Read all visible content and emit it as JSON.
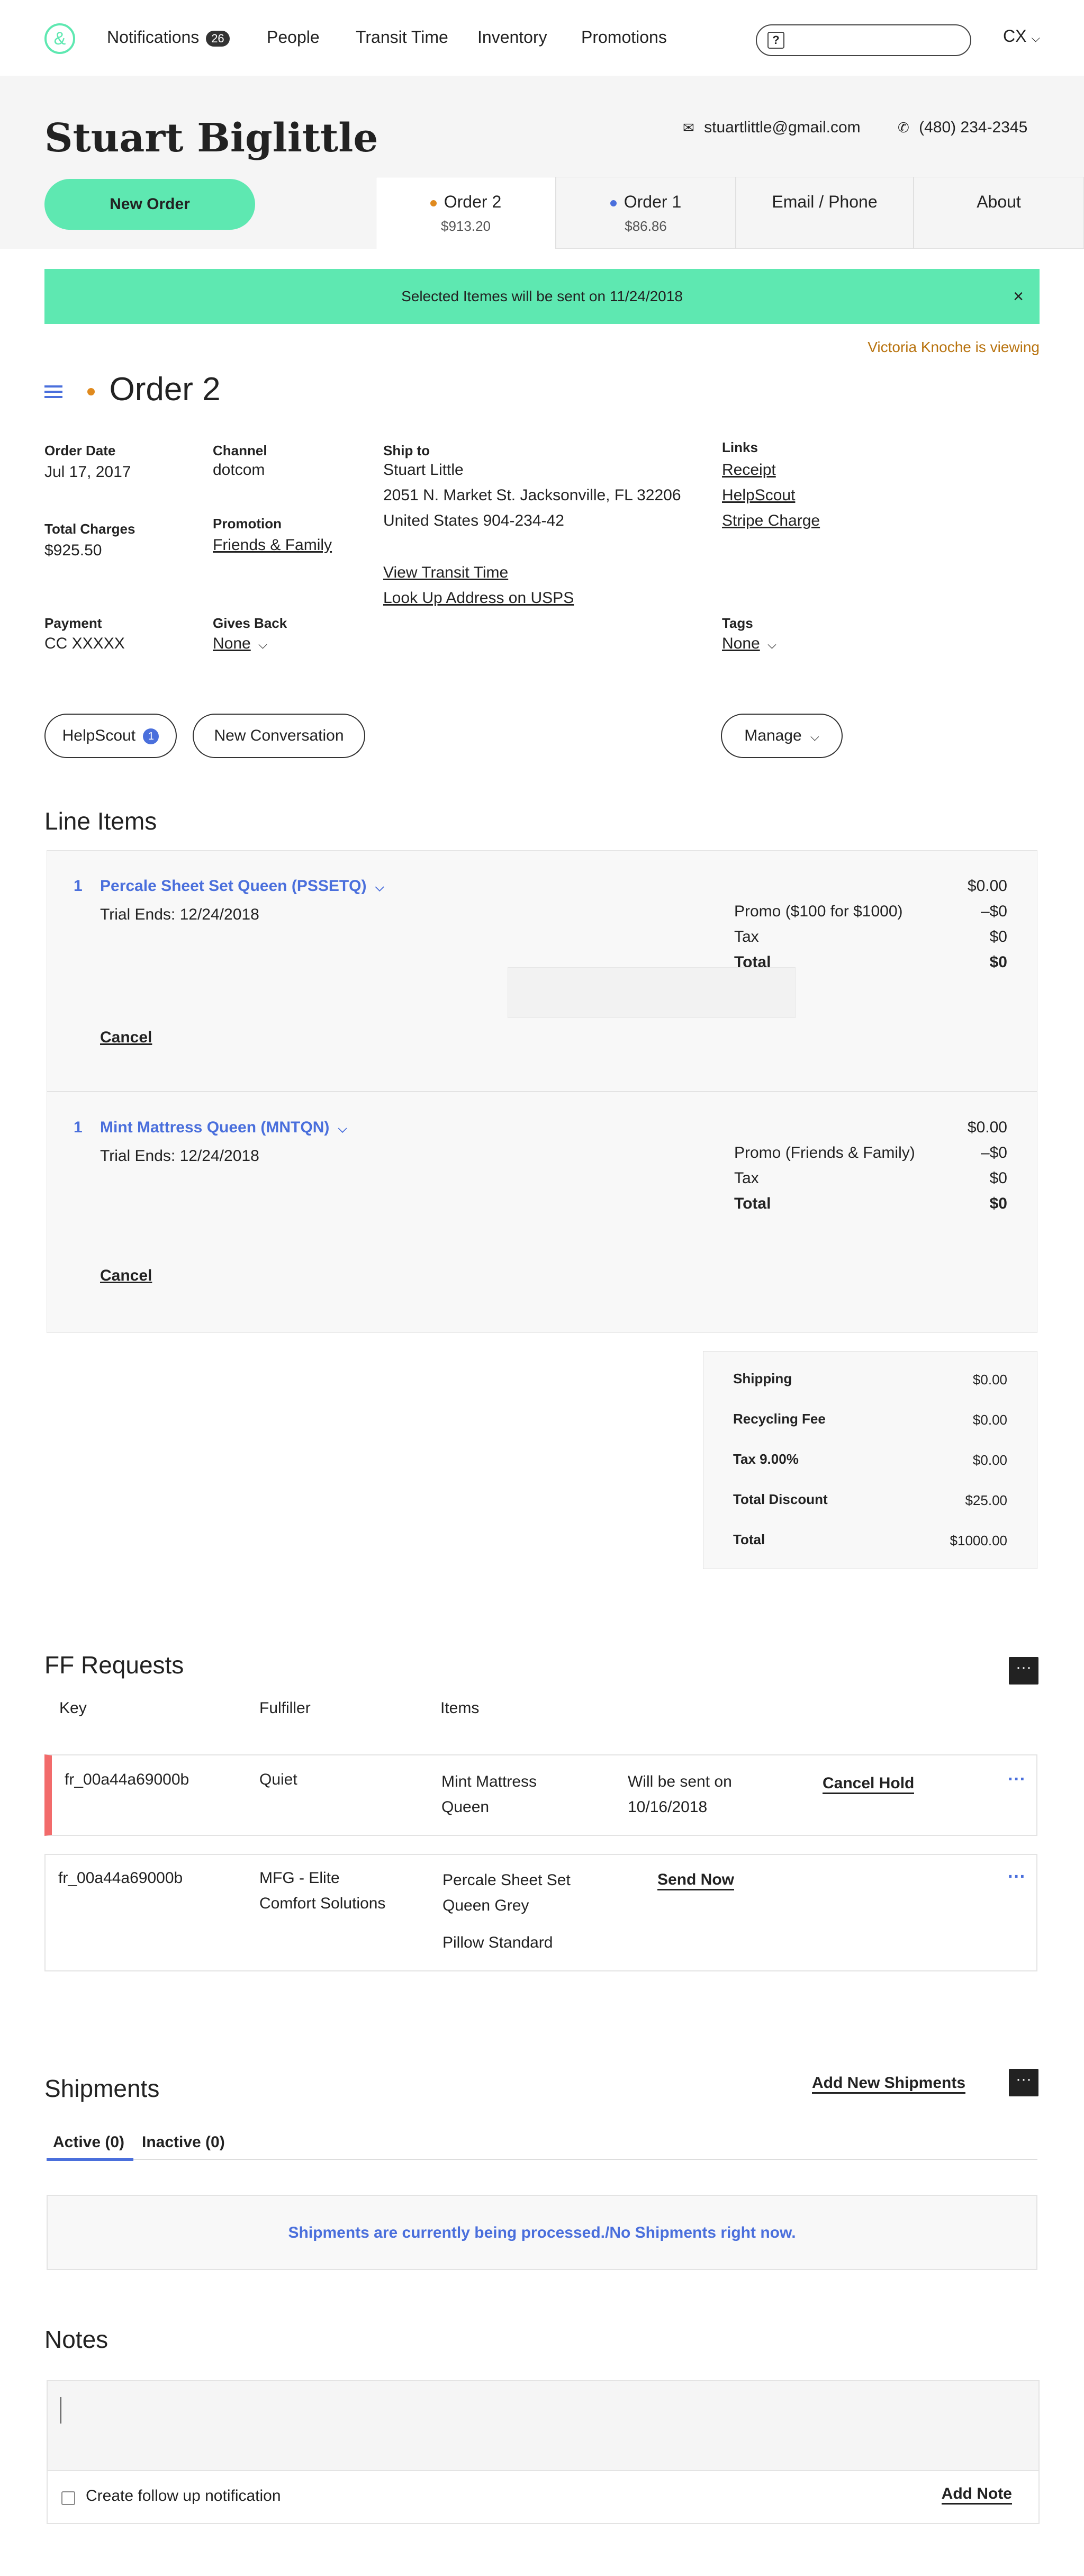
{
  "nav": {
    "logo_glyph": "&",
    "items": [
      "Notifications",
      "People",
      "Transit Time",
      "Inventory",
      "Promotions"
    ],
    "notifications_count": "26",
    "search_glyph": "?",
    "user": "CX"
  },
  "customer": {
    "name": "Stuart Biglittle",
    "email": "stuartlittle@gmail.com",
    "phone": "(480) 234-2345",
    "new_order_label": "New Order"
  },
  "tabs": [
    {
      "label": "Order 2",
      "amount": "$913.20",
      "dot_color": "#e08a1e"
    },
    {
      "label": "Order 1",
      "amount": "$86.86",
      "dot_color": "#4a6fdc"
    },
    {
      "label": "Email / Phone"
    },
    {
      "label": "About"
    }
  ],
  "alert": {
    "text": "Selected Itemes will be sent on 11/24/2018",
    "close": "×"
  },
  "viewing": "Victoria Knoche is viewing",
  "order": {
    "title": "Order 2",
    "order_date_label": "Order Date",
    "order_date": "Jul 17, 2017",
    "channel_label": "Channel",
    "channel": "dotcom",
    "ship_to_label": "Ship to",
    "ship_name": "Stuart Little",
    "ship_addr": "2051 N. Market St. Jacksonville, FL 32206",
    "ship_country": "United States  904-234-42",
    "view_transit": "View Transit Time",
    "lookup_usps": "Look Up Address on USPS",
    "links_label": "Links",
    "links": [
      "Receipt",
      "HelpScout",
      "Stripe Charge"
    ],
    "total_charges_label": "Total Charges",
    "total_charges": "$925.50",
    "promotion_label": "Promotion",
    "promotion": "Friends & Family",
    "payment_label": "Payment",
    "payment": "CC XXXXX",
    "gives_back_label": "Gives Back",
    "gives_back": "None",
    "tags_label": "Tags",
    "tags": "None"
  },
  "actions": {
    "helpscout": "HelpScout",
    "helpscout_count": "1",
    "new_conversation": "New Conversation",
    "manage": "Manage"
  },
  "line_items": {
    "title": "Line Items",
    "items": [
      {
        "qty": "1",
        "name": "Percale Sheet Set Queen  (PSSETQ)",
        "trial": "Trial Ends: 12/24/2018",
        "price": "$0.00",
        "promo_label": "Promo ($100 for $1000)",
        "promo": "–$0",
        "tax_label": "Tax",
        "tax": "$0",
        "total_label": "Total",
        "total": "$0",
        "cancel": "Cancel"
      },
      {
        "qty": "1",
        "name": "Mint Mattress Queen (MNTQN)",
        "trial": "Trial Ends: 12/24/2018",
        "price": "$0.00",
        "promo_label": "Promo (Friends & Family)",
        "promo": "–$0",
        "tax_label": "Tax",
        "tax": "$0",
        "total_label": "Total",
        "total": "$0",
        "cancel": "Cancel"
      }
    ]
  },
  "totals": [
    {
      "label": "Shipping",
      "value": "$0.00"
    },
    {
      "label": "Recycling Fee",
      "value": "$0.00"
    },
    {
      "label": "Tax 9.00%",
      "value": "$0.00"
    },
    {
      "label": "Total Discount",
      "value": "$25.00"
    },
    {
      "label": "Total",
      "value": "$1000.00"
    }
  ],
  "ff": {
    "title": "FF Requests",
    "more": "···",
    "headers": [
      "Key",
      "Fulfiller",
      "Items"
    ],
    "rows": [
      {
        "key": "fr_00a44a69000b",
        "fulfiller": "Quiet",
        "items": [
          "Mint Mattress",
          "Queen"
        ],
        "status": [
          "Will be sent on",
          "10/16/2018"
        ],
        "action": "Cancel Hold",
        "more": "···",
        "accent": "#f26b6b"
      },
      {
        "key": "fr_00a44a69000b",
        "fulfiller": [
          "MFG - Elite",
          "Comfort Solutions"
        ],
        "items": [
          "Percale Sheet Set",
          "Queen Grey",
          "Pillow Standard"
        ],
        "action": "Send Now",
        "more": "···"
      }
    ]
  },
  "shipments": {
    "title": "Shipments",
    "add": "Add New Shipments",
    "more": "···",
    "tab_active": "Active (0)",
    "tab_inactive": "Inactive (0)",
    "message": "Shipments are currently being processed./No Shipments right now."
  },
  "notes": {
    "title": "Notes",
    "follow_up": "Create follow up notification",
    "add": "Add Note"
  },
  "colors": {
    "accent_green": "#5ee8b1",
    "link_blue": "#4a6fdc",
    "alert_orange": "#b8730f"
  }
}
